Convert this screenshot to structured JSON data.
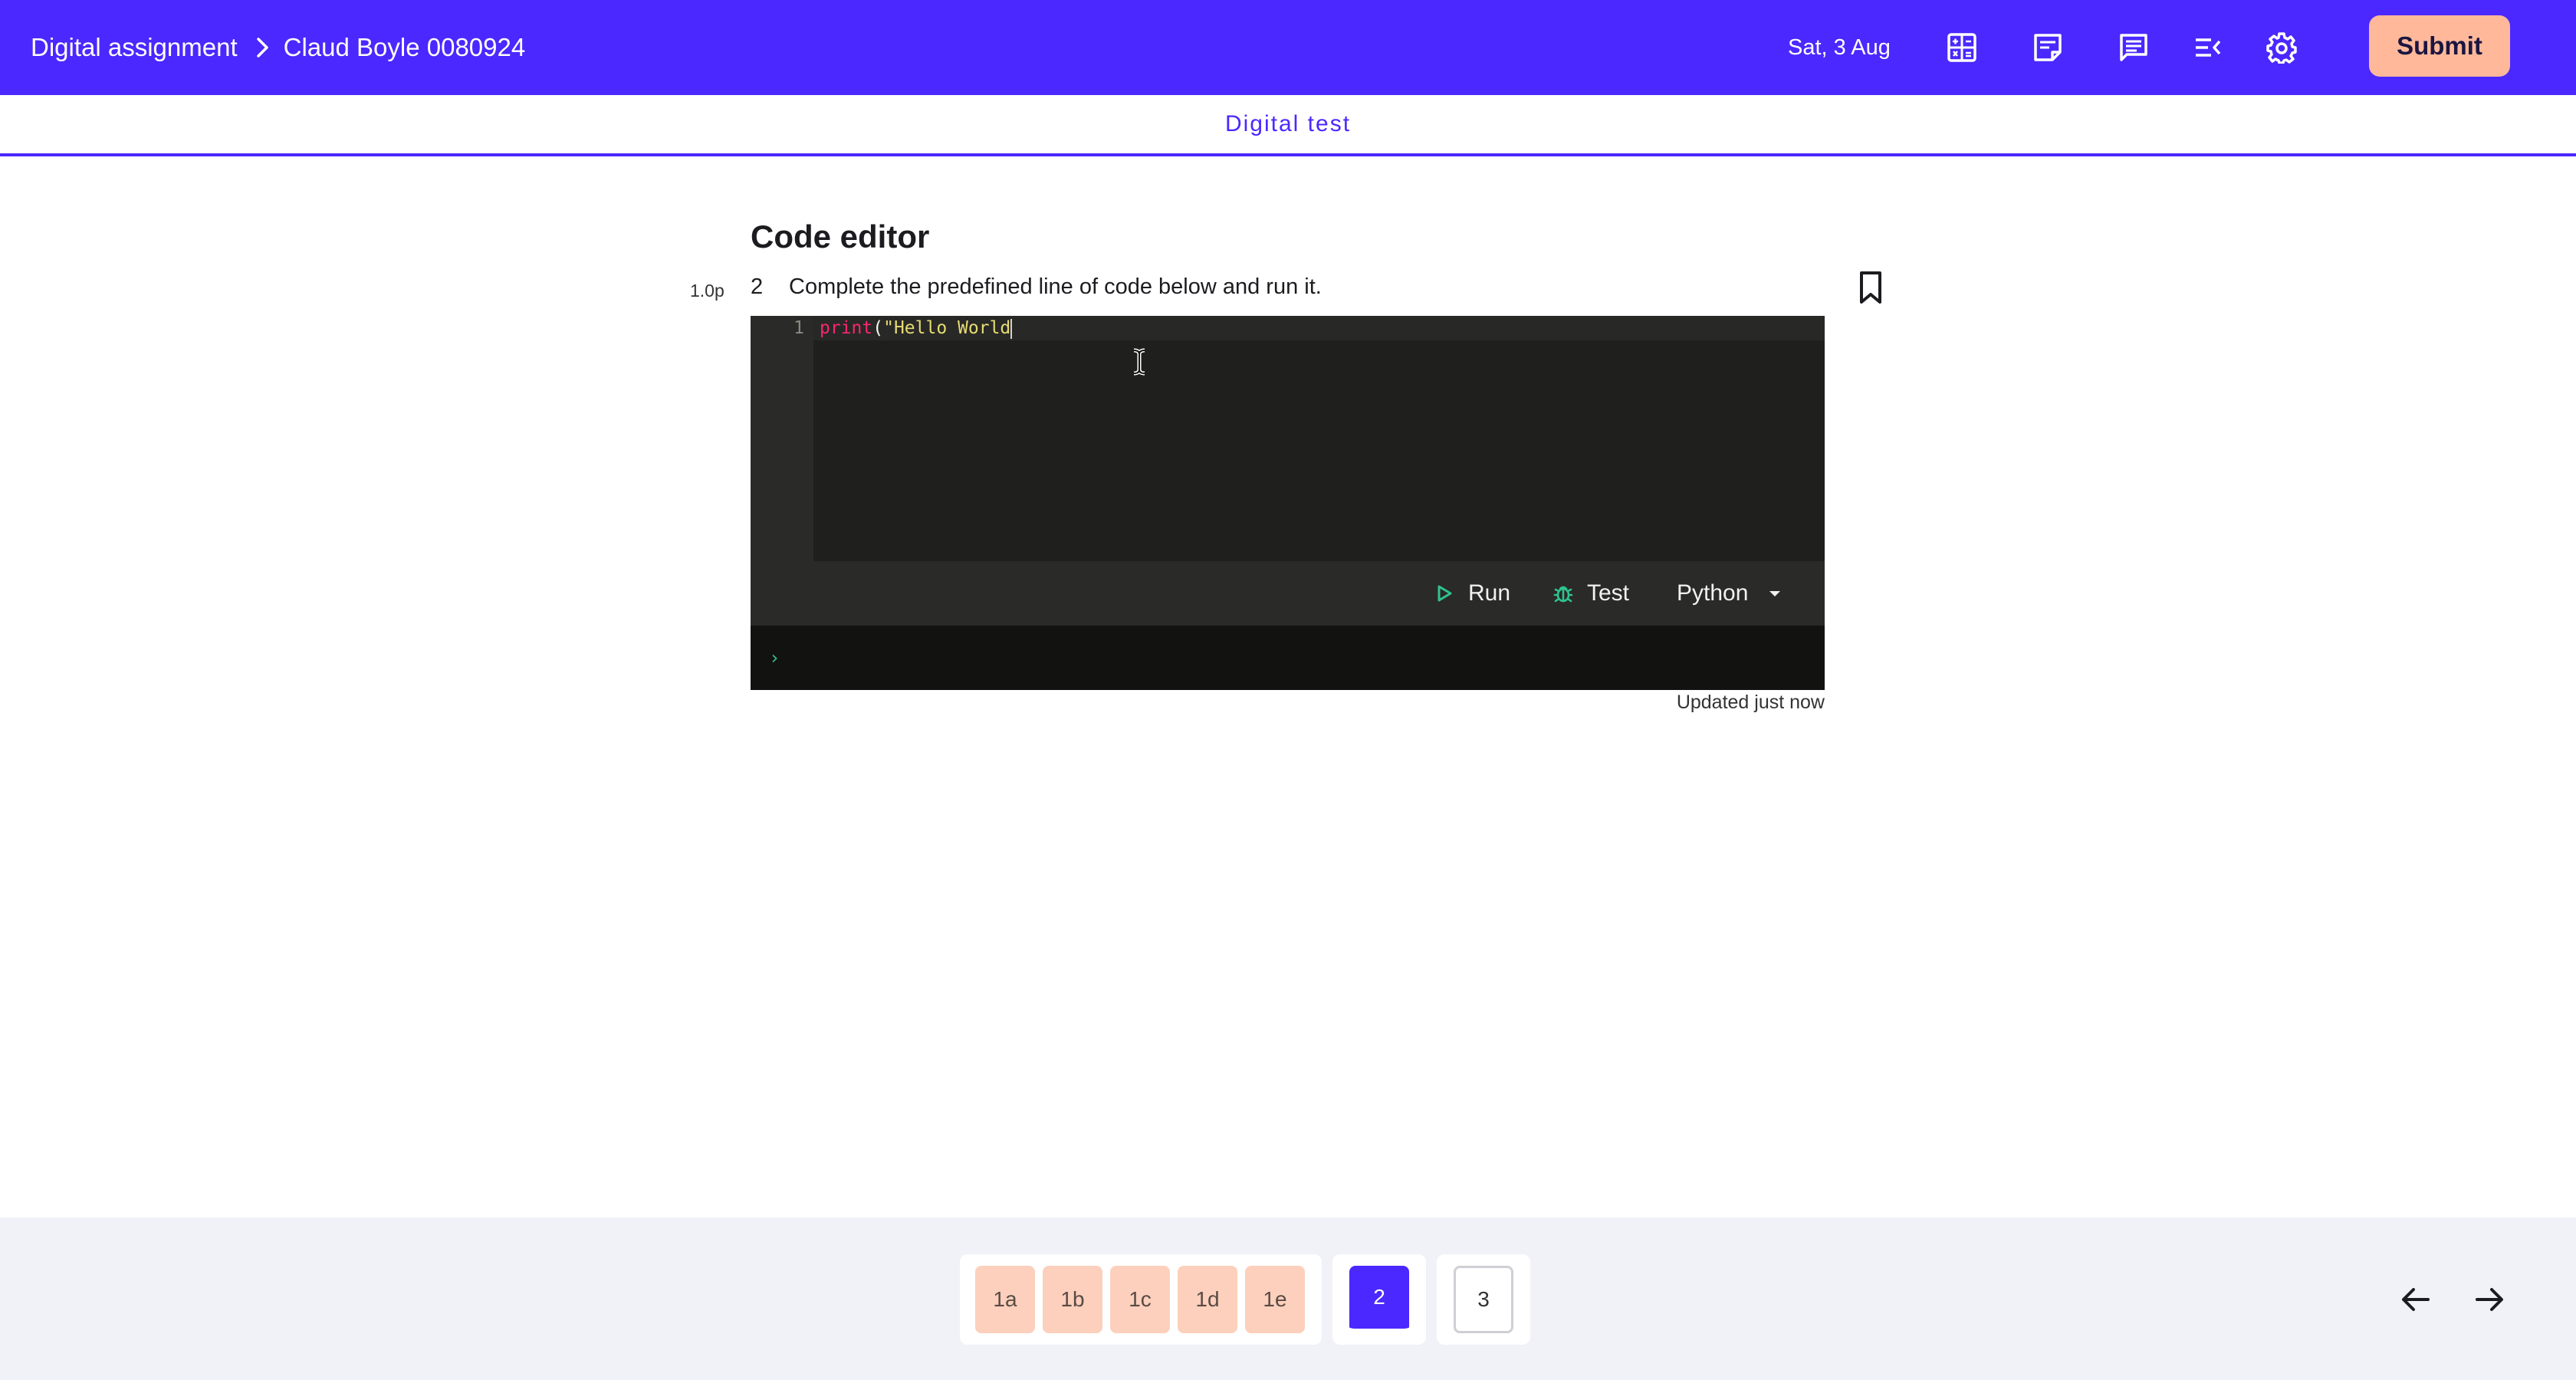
{
  "header": {
    "breadcrumb_root": "Digital assignment",
    "breadcrumb_current": "Claud Boyle 0080924",
    "date": "Sat, 3 Aug",
    "icons": [
      "calculator-icon",
      "notes-icon",
      "chat-icon",
      "menu-collapse-icon",
      "gear-icon"
    ],
    "submit_label": "Submit",
    "accent_color": "#4a28ff",
    "submit_color": "#ffb99a"
  },
  "subheader": {
    "title": "Digital test"
  },
  "question": {
    "section_title": "Code editor",
    "points": "1.0p",
    "number": "2",
    "text": "Complete the predefined line of code below and run it."
  },
  "editor": {
    "line_number": "1",
    "code_fn": "print",
    "code_paren": "(",
    "code_string": "\"Hello World",
    "run_label": "Run",
    "test_label": "Test",
    "language": "Python",
    "console_prompt": "›",
    "updated_text": "Updated just now"
  },
  "footer": {
    "questions_group1": [
      "1a",
      "1b",
      "1c",
      "1d",
      "1e"
    ],
    "current_question": "2",
    "next_question": "3"
  }
}
